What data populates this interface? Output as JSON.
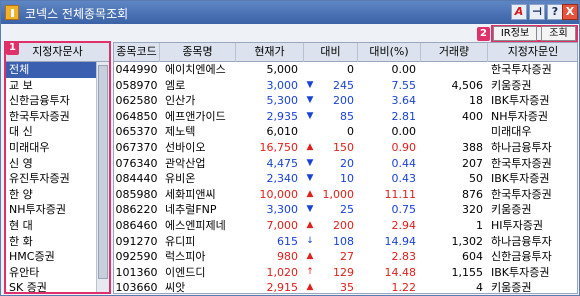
{
  "title": "코넥스 전체종목조회",
  "titlebar_buttons": {
    "a": "A",
    "pin": "⊣",
    "help": "?",
    "close": "X"
  },
  "toolbar": {
    "badge2": "2",
    "ir_label": "IR정보",
    "lookup_label": "조회"
  },
  "left_panel": {
    "badge": "1",
    "header": "지정자문사",
    "items": [
      "전체",
      "교  보",
      "신한금융투자",
      "한국투자증권",
      "대  신",
      "미래대우",
      "신  영",
      "유진투자증권",
      "한  양",
      "NH투자증권",
      "현  대",
      "한  화",
      "HMC증권",
      "유안타",
      "SK  증권"
    ],
    "selected_index": 0
  },
  "colors": {
    "up": "#e0201c",
    "down": "#1a43d6",
    "accent": "#e0306a",
    "selected": "#3b5fb0"
  },
  "grid": {
    "headers": [
      "종목코드",
      "종목명",
      "현재가",
      "대비",
      "대비(%)",
      "거래량",
      "지정자문인"
    ],
    "rows": [
      {
        "code": "044990",
        "name": "에이치엔에스",
        "price": "5,000",
        "arrow": "",
        "dir": "fl",
        "diff": "0",
        "pct": "0.00",
        "vol": "",
        "org": "한국투자증권"
      },
      {
        "code": "058970",
        "name": "엠로",
        "price": "3,000",
        "arrow": "▼",
        "dir": "dn",
        "diff": "245",
        "pct": "7.55",
        "vol": "4,506",
        "org": "키움증권"
      },
      {
        "code": "062580",
        "name": "인산가",
        "price": "5,300",
        "arrow": "▼",
        "dir": "dn",
        "diff": "200",
        "pct": "3.64",
        "vol": "18",
        "org": "IBK투자증권"
      },
      {
        "code": "064850",
        "name": "에프앤가이드",
        "price": "2,935",
        "arrow": "▼",
        "dir": "dn",
        "diff": "85",
        "pct": "2.81",
        "vol": "400",
        "org": "NH투자증권"
      },
      {
        "code": "065370",
        "name": "제노텍",
        "price": "6,010",
        "arrow": "",
        "dir": "fl",
        "diff": "0",
        "pct": "0.00",
        "vol": "",
        "org": "미래대우"
      },
      {
        "code": "067370",
        "name": "선바이오",
        "price": "16,750",
        "arrow": "▲",
        "dir": "up",
        "diff": "150",
        "pct": "0.90",
        "vol": "388",
        "org": "하나금융투자"
      },
      {
        "code": "076340",
        "name": "관악산업",
        "price": "4,475",
        "arrow": "▼",
        "dir": "dn",
        "diff": "20",
        "pct": "0.44",
        "vol": "207",
        "org": "한국투자증권"
      },
      {
        "code": "084440",
        "name": "유비온",
        "price": "2,340",
        "arrow": "▼",
        "dir": "dn",
        "diff": "10",
        "pct": "0.43",
        "vol": "50",
        "org": "IBK투자증권"
      },
      {
        "code": "085980",
        "name": "세화피앤씨",
        "price": "10,000",
        "arrow": "▲",
        "dir": "up",
        "diff": "1,000",
        "pct": "11.11",
        "vol": "876",
        "org": "한국투자증권"
      },
      {
        "code": "086220",
        "name": "네추럴FNP",
        "price": "3,300",
        "arrow": "▼",
        "dir": "dn",
        "diff": "25",
        "pct": "0.75",
        "vol": "320",
        "org": "키움증권"
      },
      {
        "code": "086460",
        "name": "에스엔피제네",
        "price": "7,000",
        "arrow": "▲",
        "dir": "up",
        "diff": "200",
        "pct": "2.94",
        "vol": "1",
        "org": "HI투자증권"
      },
      {
        "code": "091270",
        "name": "유디피",
        "price": "615",
        "arrow": "↓",
        "dir": "dn",
        "diff": "108",
        "pct": "14.94",
        "vol": "1,302",
        "org": "하나금융투자"
      },
      {
        "code": "092590",
        "name": "럭스피아",
        "price": "980",
        "arrow": "▲",
        "dir": "up",
        "diff": "27",
        "pct": "2.83",
        "vol": "604",
        "org": "신한금융투자"
      },
      {
        "code": "101360",
        "name": "이엔드디",
        "price": "1,020",
        "arrow": "↑",
        "dir": "up",
        "diff": "129",
        "pct": "14.48",
        "vol": "1,155",
        "org": "IBK투자증권"
      },
      {
        "code": "103660",
        "name": "씨앗",
        "price": "2,915",
        "arrow": "▲",
        "dir": "up",
        "diff": "35",
        "pct": "1.22",
        "vol": "4",
        "org": "키움증권"
      }
    ]
  }
}
